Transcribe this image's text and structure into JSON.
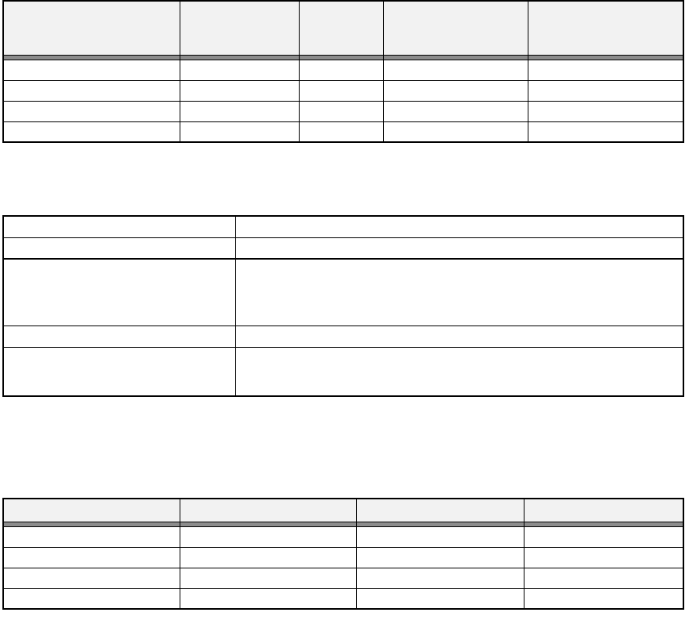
{
  "table1": {
    "headers": [
      "",
      "",
      "",
      "",
      ""
    ],
    "rows": [
      [
        "",
        "",
        "",
        "",
        ""
      ],
      [
        "",
        "",
        "",
        "",
        ""
      ],
      [
        "",
        "",
        "",
        "",
        ""
      ],
      [
        "",
        "",
        "",
        "",
        ""
      ]
    ]
  },
  "table2": {
    "rows": [
      [
        "",
        ""
      ],
      [
        "",
        ""
      ],
      [
        "",
        ""
      ],
      [
        "",
        ""
      ],
      [
        "",
        ""
      ]
    ]
  },
  "table3": {
    "headers": [
      "",
      "",
      "",
      ""
    ],
    "rows": [
      [
        "",
        "",
        "",
        ""
      ],
      [
        "",
        "",
        "",
        ""
      ],
      [
        "",
        "",
        "",
        ""
      ],
      [
        "",
        "",
        "",
        ""
      ]
    ]
  }
}
